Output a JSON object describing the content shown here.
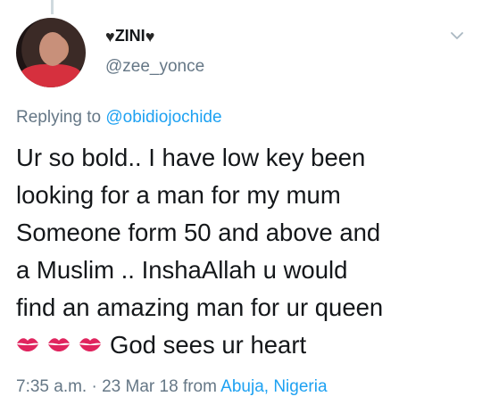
{
  "tweet": {
    "author": {
      "display_name": "ZINI",
      "username": "@zee_yonce",
      "name_decoration_icon": "black-heart-icon"
    },
    "reply": {
      "prefix": "Replying to",
      "mention": "@obidiojochide"
    },
    "text_lines": [
      "Ur so bold.. I have low key been",
      "looking for a man for my mum",
      "Someone form 50 and above and",
      "a Muslim .. InshaAllah u would",
      "find an amazing man for ur queen"
    ],
    "last_line": {
      "emoji_icons": [
        "kiss-mark-icon",
        "kiss-mark-icon",
        "kiss-mark-icon"
      ],
      "text": "God sees ur heart"
    },
    "meta": {
      "time_date": "7:35 a.m. · 23 Mar 18",
      "from_label": "from",
      "location": "Abuja, Nigeria"
    }
  },
  "colors": {
    "text": "#14171a",
    "secondary": "#657786",
    "link": "#1da1f2",
    "kiss": "#e0245e"
  }
}
